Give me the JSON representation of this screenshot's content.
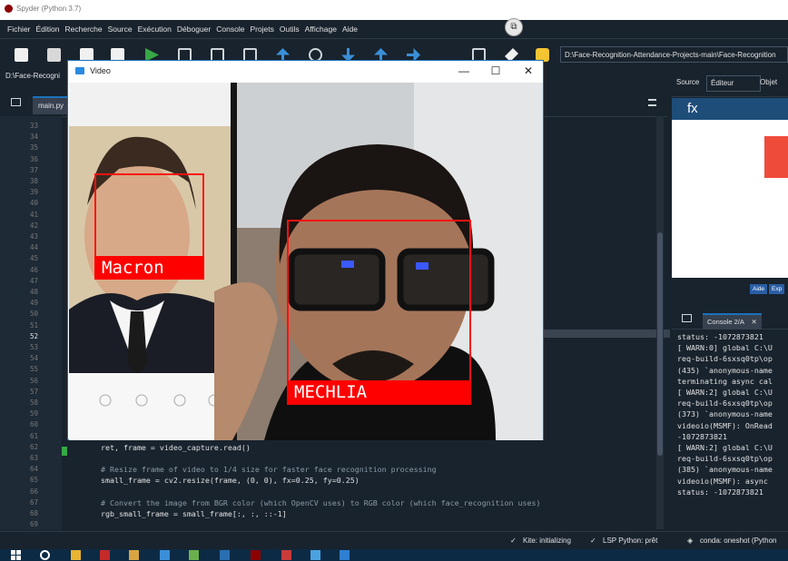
{
  "window": {
    "title": "Spyder (Python 3.7)"
  },
  "menu": [
    "Fichier",
    "Édition",
    "Recherche",
    "Source",
    "Exécution",
    "Déboguer",
    "Console",
    "Projets",
    "Outils",
    "Affichage",
    "Aide"
  ],
  "toolbar": {
    "path": "D:\\Face-Recognition-Attendance-Projects-main\\Face-Recognition"
  },
  "editor": {
    "path_label": "D:\\Face-Recogni",
    "tab": "main.py",
    "line_numbers": [
      "33",
      "34",
      "35",
      "36",
      "37",
      "38",
      "39",
      "40",
      "41",
      "42",
      "43",
      "44",
      "45",
      "46",
      "47",
      "48",
      "49",
      "50",
      "51",
      "52",
      "53",
      "54",
      "55",
      "56",
      "57",
      "58",
      "59",
      "60",
      "61",
      "62",
      "63",
      "64",
      "65",
      "66",
      "67",
      "68",
      "69"
    ],
    "current_line": "52",
    "code_lines": [
      {
        "ln": "62",
        "text": "    ret, frame = video_capture.read()",
        "type": "code"
      },
      {
        "ln": "63",
        "text": "",
        "type": "code"
      },
      {
        "ln": "64",
        "text": "    # Resize frame of video to 1/4 size for faster face recognition processing",
        "type": "comment"
      },
      {
        "ln": "65",
        "text": "    small_frame = cv2.resize(frame, (0, 0), fx=0.25, fy=0.25)",
        "type": "code"
      },
      {
        "ln": "66",
        "text": "",
        "type": "code"
      },
      {
        "ln": "67",
        "text": "    # Convert the image from BGR color (which OpenCV uses) to RGB color (which face_recognition uses)",
        "type": "comment"
      },
      {
        "ln": "68",
        "text": "    rgb_small_frame = small_frame[:, :, ::-1]",
        "type": "code"
      }
    ]
  },
  "help": {
    "source_label": "Source",
    "source_value": "Éditeur",
    "object_label": "Objet",
    "fx": "fx",
    "tabs": [
      "Aide",
      "Exp"
    ]
  },
  "console": {
    "tab": "Console 2/A",
    "lines": [
      "status: -1072873821",
      "[ WARN:0] global C:\\U",
      "req-build-6sxsq0tp\\op",
      "(435) `anonymous-name",
      "terminating async cal",
      "[ WARN:2] global C:\\U",
      "req-build-6sxsq0tp\\op",
      "(373) `anonymous-name",
      "videoio(MSMF): OnRead",
      "-1072873821",
      "[ WARN:2] global C:\\U",
      "req-build-6sxsq0tp\\op",
      "(385) `anonymous-name",
      "videoio(MSMF): async",
      "status: -1072873821"
    ]
  },
  "status": {
    "kite": "Kite: initializing",
    "lsp": "LSP Python: prêt",
    "conda": "conda: oneshot (Python"
  },
  "video": {
    "title": "Video",
    "faces": [
      {
        "name": "Macron"
      },
      {
        "name": "MECHLIA"
      }
    ]
  },
  "colors": {
    "bbox": "#ff0000",
    "ide_bg": "#19232d",
    "accent": "#1a72bb"
  }
}
